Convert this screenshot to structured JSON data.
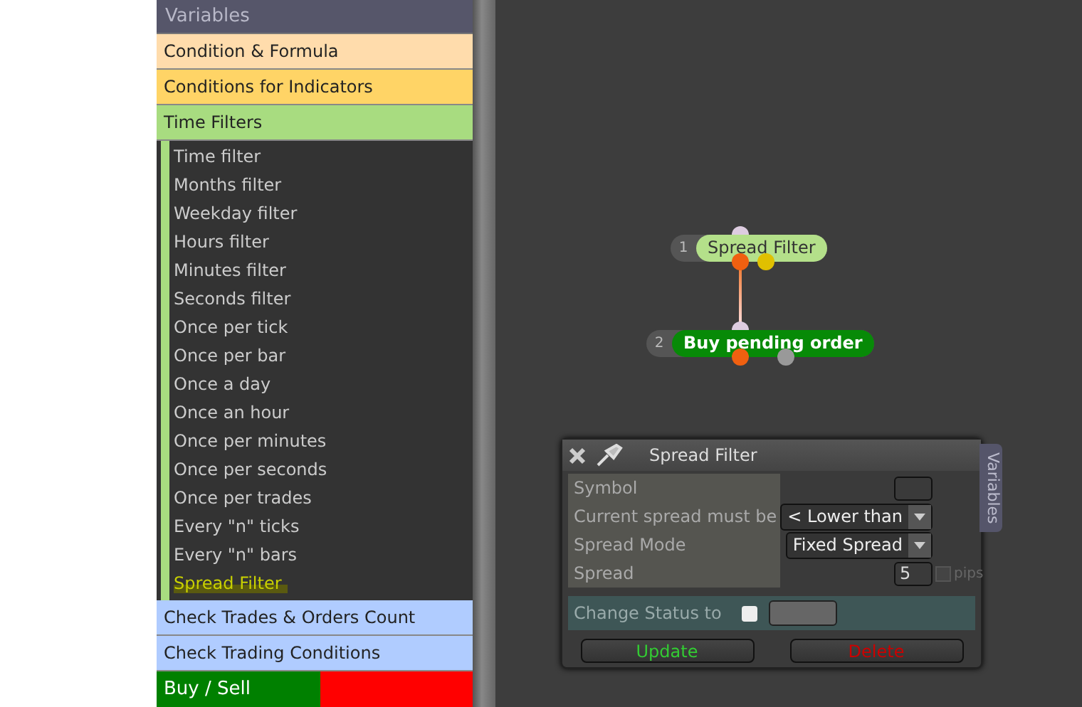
{
  "sidebar": {
    "header": "Variables",
    "categories": [
      {
        "label": "Condition & Formula",
        "color": "#ffdcac"
      },
      {
        "label": "Conditions for Indicators",
        "color": "#ffd466"
      },
      {
        "label": "Time Filters",
        "color": "#a8dc80",
        "expanded": true,
        "children": [
          {
            "label": "Time filter",
            "selected": false
          },
          {
            "label": "Months filter",
            "selected": false
          },
          {
            "label": "Weekday filter",
            "selected": false
          },
          {
            "label": "Hours filter",
            "selected": false
          },
          {
            "label": "Minutes filter",
            "selected": false
          },
          {
            "label": "Seconds filter",
            "selected": false
          },
          {
            "label": "Once per tick",
            "selected": false
          },
          {
            "label": "Once per bar",
            "selected": false
          },
          {
            "label": "Once a day",
            "selected": false
          },
          {
            "label": "Once an hour",
            "selected": false
          },
          {
            "label": "Once per minutes",
            "selected": false
          },
          {
            "label": "Once per seconds",
            "selected": false
          },
          {
            "label": "Once per trades",
            "selected": false
          },
          {
            "label": "Every \"n\" ticks",
            "selected": false
          },
          {
            "label": "Every \"n\" bars",
            "selected": false
          },
          {
            "label": "Spread Filter",
            "selected": true
          }
        ]
      },
      {
        "label": "Check Trades & Orders Count",
        "color": "#b0ccff"
      },
      {
        "label": "Check Trading Conditions",
        "color": "#b0ccff"
      }
    ],
    "buy_sell": "Buy / Sell"
  },
  "nodes": [
    {
      "number": "1",
      "label": "Spread Filter",
      "kind": "filter"
    },
    {
      "number": "2",
      "label": "Buy pending order",
      "kind": "action"
    }
  ],
  "dialog": {
    "title": "Spread Filter",
    "side_tab": "Variables",
    "fields": [
      {
        "label": "Symbol",
        "kind": "text"
      },
      {
        "label": "Current spread must be",
        "kind": "dropdown",
        "value": "< Lower than"
      },
      {
        "label": "Spread Mode",
        "kind": "dropdown",
        "value": "Fixed Spread"
      },
      {
        "label": "Spread",
        "kind": "number",
        "value": "5",
        "unit": "pips",
        "unit_checked": false
      }
    ],
    "status": {
      "label": "Change Status to",
      "checked": false
    },
    "buttons": [
      {
        "label": "Update",
        "kind": "ok"
      },
      {
        "label": "Delete",
        "kind": "danger"
      }
    ]
  }
}
